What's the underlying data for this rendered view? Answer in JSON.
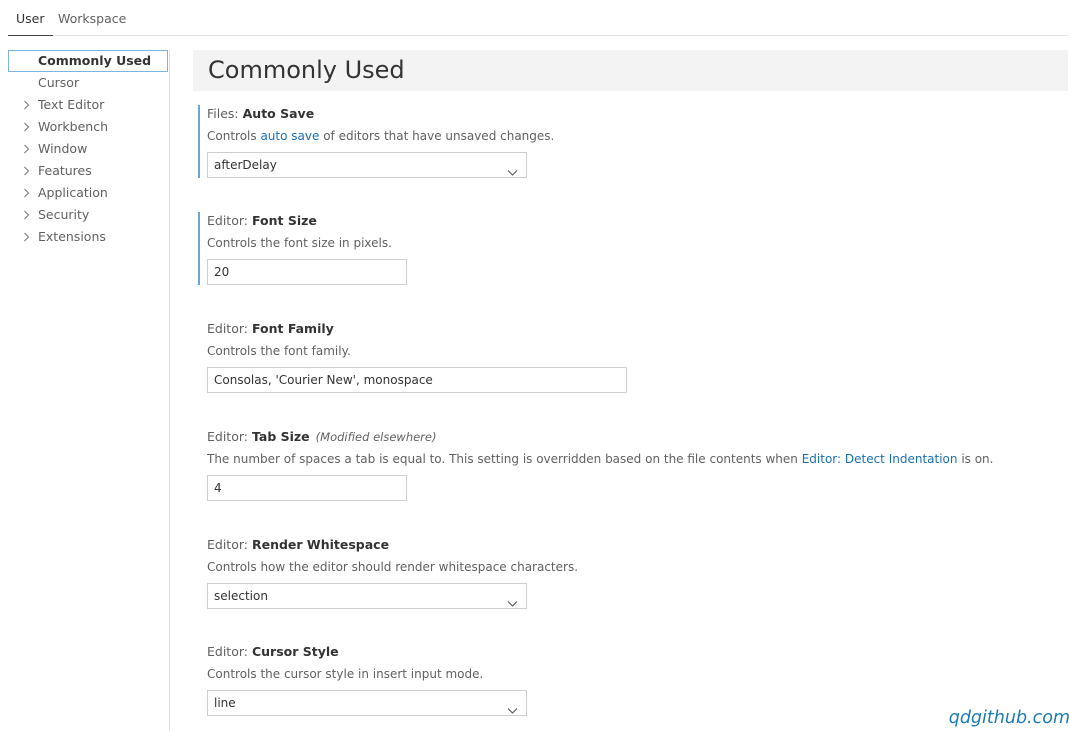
{
  "tabs": {
    "user": "User",
    "workspace": "Workspace"
  },
  "sidebar": {
    "items": [
      {
        "label": "Commonly Used"
      },
      {
        "label": "Cursor"
      },
      {
        "label": "Text Editor"
      },
      {
        "label": "Workbench"
      },
      {
        "label": "Window"
      },
      {
        "label": "Features"
      },
      {
        "label": "Application"
      },
      {
        "label": "Security"
      },
      {
        "label": "Extensions"
      }
    ]
  },
  "main": {
    "title": "Commonly Used",
    "settings": {
      "auto_save": {
        "category": "Files: ",
        "name": "Auto Save",
        "desc_pre": "Controls ",
        "desc_link": "auto save",
        "desc_post": " of editors that have unsaved changes.",
        "value": "afterDelay"
      },
      "font_size": {
        "category": "Editor: ",
        "name": "Font Size",
        "desc": "Controls the font size in pixels.",
        "value": "20"
      },
      "font_family": {
        "category": "Editor: ",
        "name": "Font Family",
        "desc": "Controls the font family.",
        "value": "Consolas, 'Courier New', monospace"
      },
      "tab_size": {
        "category": "Editor: ",
        "name": "Tab Size",
        "modified": "(Modified elsewhere)",
        "desc_pre": "The number of spaces a tab is equal to. This setting is overridden based on the file contents when ",
        "desc_link": "Editor: Detect Indentation",
        "desc_post": " is on.",
        "value": "4"
      },
      "render_whitespace": {
        "category": "Editor: ",
        "name": "Render Whitespace",
        "desc": "Controls how the editor should render whitespace characters.",
        "value": "selection"
      },
      "cursor_style": {
        "category": "Editor: ",
        "name": "Cursor Style",
        "desc": "Controls the cursor style in insert input mode.",
        "value": "line"
      }
    }
  },
  "watermark": "qdgithub.com",
  "colors": {
    "accent": "#67a6d6",
    "link": "#1a6fb5",
    "selected_border": "#7fb3e0",
    "title_bg": "#f3f3f3"
  }
}
